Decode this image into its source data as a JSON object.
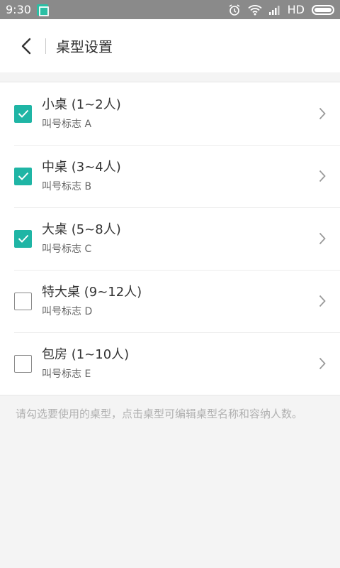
{
  "status_bar": {
    "time": "9:30",
    "network_label": "HD"
  },
  "header": {
    "title": "桌型设置"
  },
  "table_types": [
    {
      "name": "小桌 (1~2人)",
      "call_label": "叫号标志 A",
      "checked": true
    },
    {
      "name": "中桌 (3~4人)",
      "call_label": "叫号标志 B",
      "checked": true
    },
    {
      "name": "大桌 (5~8人)",
      "call_label": "叫号标志 C",
      "checked": true
    },
    {
      "name": "特大桌 (9~12人)",
      "call_label": "叫号标志 D",
      "checked": false
    },
    {
      "name": "包房 (1~10人)",
      "call_label": "叫号标志 E",
      "checked": false
    }
  ],
  "hint": "请勾选要使用的桌型，点击桌型可编辑桌型名称和容纳人数。",
  "colors": {
    "accent": "#1fb5a5",
    "status_bar": "#8a8a8a"
  }
}
